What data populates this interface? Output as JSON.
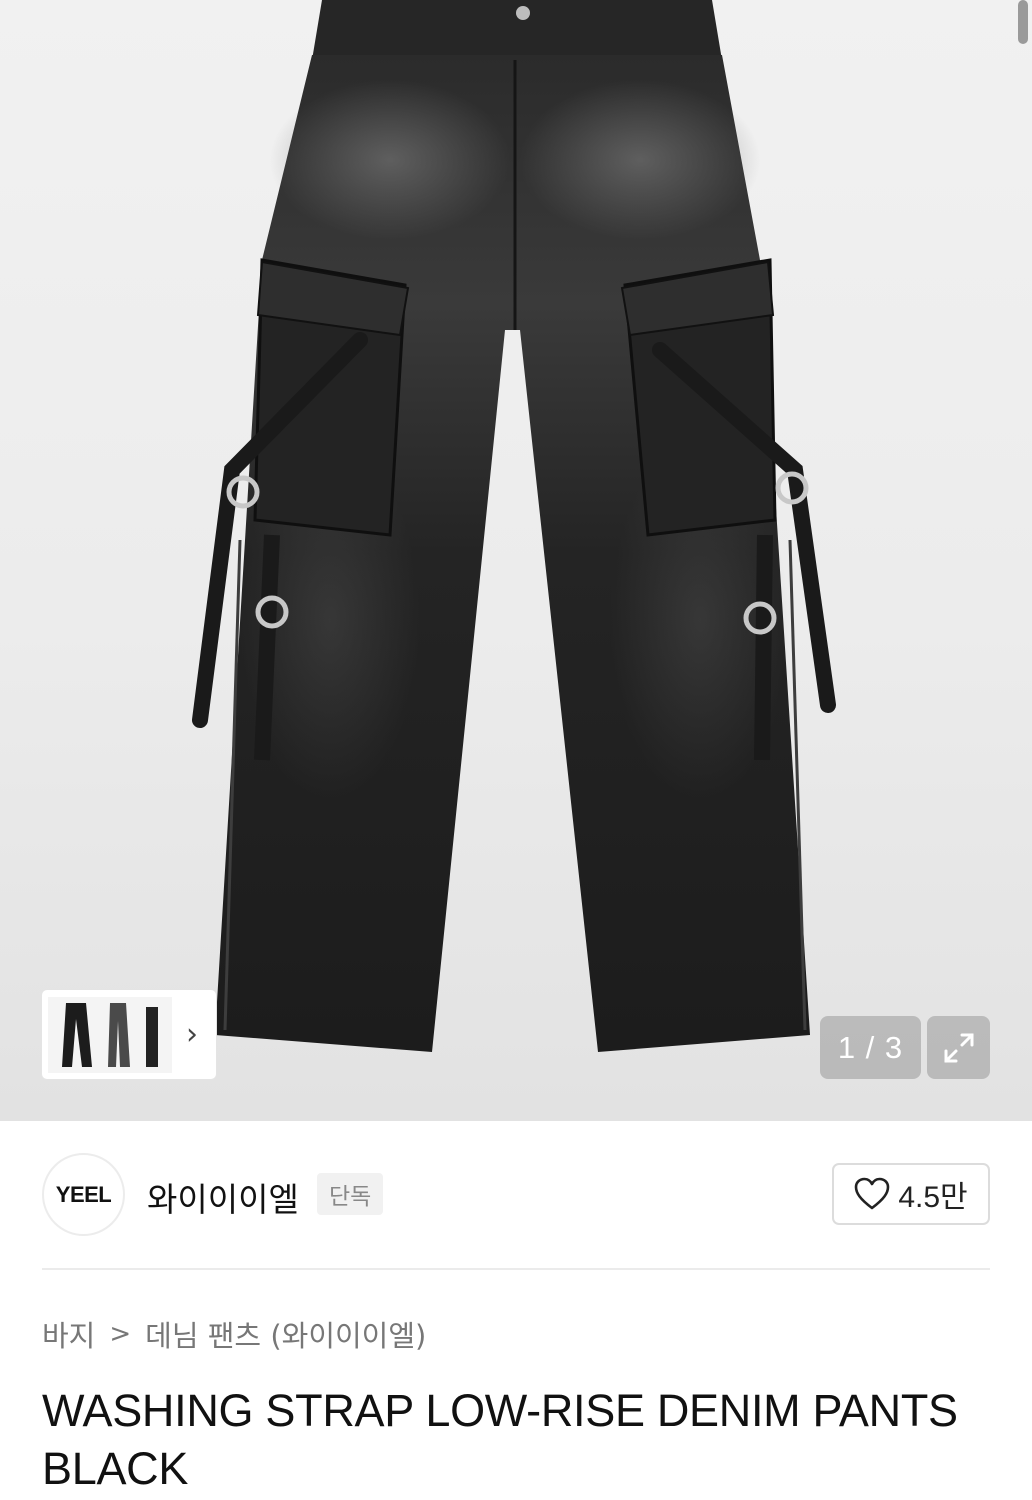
{
  "gallery": {
    "counter": "1 / 3",
    "thumbnail_chevron": "›",
    "expand_icon": "expand-icon"
  },
  "brand": {
    "logo_text": "YEEL",
    "name": "와이이이엘",
    "badge": "단독",
    "like_count": "4.5만",
    "like_icon": "heart-outline-icon"
  },
  "breadcrumb": {
    "items": [
      "바지",
      "데님 팬츠 (와이이이엘)"
    ],
    "separator": ">"
  },
  "product": {
    "title": "WASHING STRAP LOW-RISE DENIM PANTS BLACK"
  }
}
